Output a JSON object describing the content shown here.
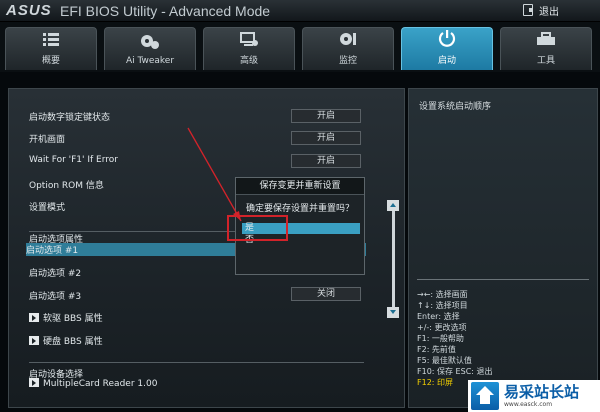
{
  "header": {
    "logo": "ASUS",
    "title": "EFI BIOS Utility - Advanced Mode",
    "exit_label": "退出"
  },
  "tabs": [
    {
      "label": "概要",
      "icon": "list-icon",
      "active": false
    },
    {
      "label": "Ai Tweaker",
      "icon": "tweaker-icon",
      "active": false
    },
    {
      "label": "高级",
      "icon": "advanced-icon",
      "active": false
    },
    {
      "label": "监控",
      "icon": "fan-icon",
      "active": false
    },
    {
      "label": "启动",
      "icon": "power-icon",
      "active": true
    },
    {
      "label": "工具",
      "icon": "tool-icon",
      "active": false
    }
  ],
  "settings": {
    "numlock": {
      "label": "启动数字锁定键状态",
      "value": "开启"
    },
    "boot_screen": {
      "label": "开机画面",
      "value": "开启"
    },
    "wait_f1": {
      "label": "Wait For 'F1' If Error",
      "value": "开启"
    },
    "option_rom": {
      "label": "Option ROM 信息",
      "value": "开启"
    },
    "setup_mode": {
      "label": "设置模式"
    },
    "boot_options_header": "启动选项属性",
    "boot_option_1": {
      "label": "启动选项 #1"
    },
    "boot_option_2": {
      "label": "启动选项 #2"
    },
    "boot_option_3": {
      "label": "启动选项 #3",
      "value": "关闭"
    },
    "floppy_bbs": {
      "label": "软驱 BBS 属性"
    },
    "hdd_bbs": {
      "label": "硬盘 BBS 属性"
    },
    "boot_device_header": "启动设备选择",
    "boot_device_1": {
      "label": "MultipleCard Reader 1.00"
    }
  },
  "dialog": {
    "title": "保存变更并重新设置",
    "question": "确定要保存设置并重置吗？",
    "option_yes": "是",
    "option_no": "否"
  },
  "help": {
    "title": "设置系统启动顺序",
    "keys": [
      "→←: 选择画面",
      "↑↓: 选择项目",
      "Enter: 选择",
      "+/-: 更改选项",
      "F1: 一般帮助",
      "F2: 先前值",
      "F5: 最佳默认值",
      "F10: 保存  ESC: 退出",
      "F12: 印屏"
    ]
  },
  "watermark": {
    "text": "易采站长站",
    "sub": "www.easck.com"
  },
  "colors": {
    "accent": "#3aa2c8",
    "highlight_key": "#f3d000",
    "annotation": "#d2232a"
  }
}
